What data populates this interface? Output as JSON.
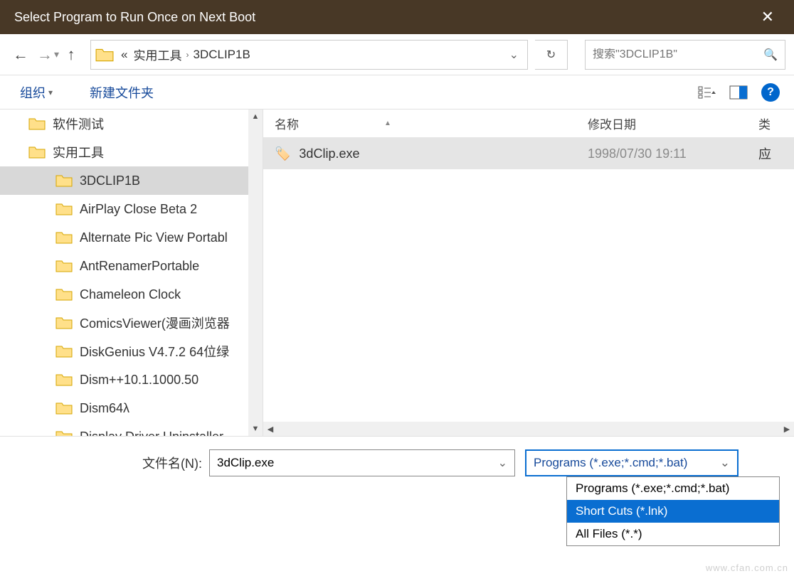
{
  "title": "Select Program to Run Once on Next Boot",
  "breadcrumb": {
    "prefix": "«",
    "a": "实用工具",
    "b": "3DCLIP1B"
  },
  "search_placeholder": "搜索\"3DCLIP1B\"",
  "toolbar": {
    "organize": "组织",
    "newfolder": "新建文件夹"
  },
  "tree": [
    {
      "label": "软件测试",
      "level": 1
    },
    {
      "label": "实用工具",
      "level": 1
    },
    {
      "label": "3DCLIP1B",
      "level": 2,
      "selected": true
    },
    {
      "label": "AirPlay Close Beta 2",
      "level": 2
    },
    {
      "label": "Alternate Pic View Portabl",
      "level": 2
    },
    {
      "label": "AntRenamerPortable",
      "level": 2
    },
    {
      "label": "Chameleon Clock",
      "level": 2
    },
    {
      "label": "ComicsViewer(漫画浏览器",
      "level": 2
    },
    {
      "label": "DiskGenius V4.7.2 64位绿",
      "level": 2
    },
    {
      "label": "Dism++10.1.1000.50",
      "level": 2
    },
    {
      "label": "Dism64λ",
      "level": 2
    },
    {
      "label": "Display Driver Uninstaller",
      "level": 2
    }
  ],
  "columns": {
    "name": "名称",
    "date": "修改日期",
    "type": "类"
  },
  "files": [
    {
      "name": "3dClip.exe",
      "date": "1998/07/30 19:11",
      "type": "应"
    }
  ],
  "filename_label": "文件名(N):",
  "filename_value": "3dClip.exe",
  "filetype_selected": "Programs (*.exe;*.cmd;*.bat)",
  "filetype_options": [
    {
      "label": "Programs (*.exe;*.cmd;*.bat)",
      "hl": false
    },
    {
      "label": "Short Cuts (*.lnk)",
      "hl": true
    },
    {
      "label": "All Files (*.*)",
      "hl": false
    }
  ],
  "watermark": "www.cfan.com.cn"
}
